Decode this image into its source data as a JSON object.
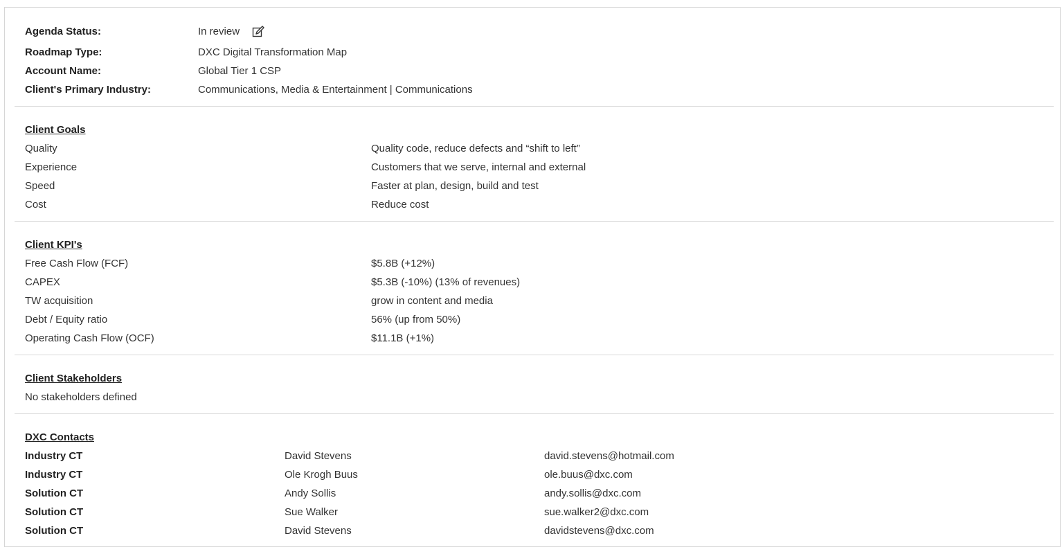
{
  "agenda": {
    "status_label": "Agenda Status:",
    "status_value": "In review",
    "edit_icon": "edit-icon",
    "roadmap_label": "Roadmap Type:",
    "roadmap_value": "DXC Digital Transformation Map",
    "account_label": "Account Name:",
    "account_value": "Global Tier 1 CSP",
    "industry_label": "Client's Primary Industry:",
    "industry_value": "Communications, Media & Entertainment | Communications"
  },
  "goals": {
    "title": "Client Goals",
    "items": [
      {
        "name": "Quality",
        "desc": "Quality code, reduce defects and “shift to left”"
      },
      {
        "name": "Experience",
        "desc": "Customers that we serve, internal and external"
      },
      {
        "name": "Speed",
        "desc": "Faster at plan, design, build and test"
      },
      {
        "name": "Cost",
        "desc": "Reduce cost"
      }
    ]
  },
  "kpis": {
    "title": "Client KPI's",
    "items": [
      {
        "name": "Free Cash Flow (FCF)",
        "value": "$5.8B (+12%)"
      },
      {
        "name": "CAPEX",
        "value": "$5.3B (-10%) (13% of revenues)"
      },
      {
        "name": "TW acquisition",
        "value": "grow in content and media"
      },
      {
        "name": "Debt / Equity ratio",
        "value": "56% (up from 50%)"
      },
      {
        "name": "Operating Cash Flow (OCF)",
        "value": "$11.1B (+1%)"
      }
    ]
  },
  "stakeholders": {
    "title": "Client Stakeholders",
    "empty_text": "No stakeholders defined"
  },
  "contacts": {
    "title": "DXC Contacts",
    "items": [
      {
        "role": "Industry CT",
        "name": "David Stevens",
        "email": "david.stevens@hotmail.com"
      },
      {
        "role": "Industry CT",
        "name": "Ole Krogh Buus",
        "email": "ole.buus@dxc.com"
      },
      {
        "role": "Solution CT",
        "name": "Andy Sollis",
        "email": "andy.sollis@dxc.com"
      },
      {
        "role": "Solution CT",
        "name": "Sue Walker",
        "email": "sue.walker2@dxc.com"
      },
      {
        "role": "Solution CT",
        "name": "David Stevens",
        "email": "davidstevens@dxc.com"
      }
    ]
  }
}
